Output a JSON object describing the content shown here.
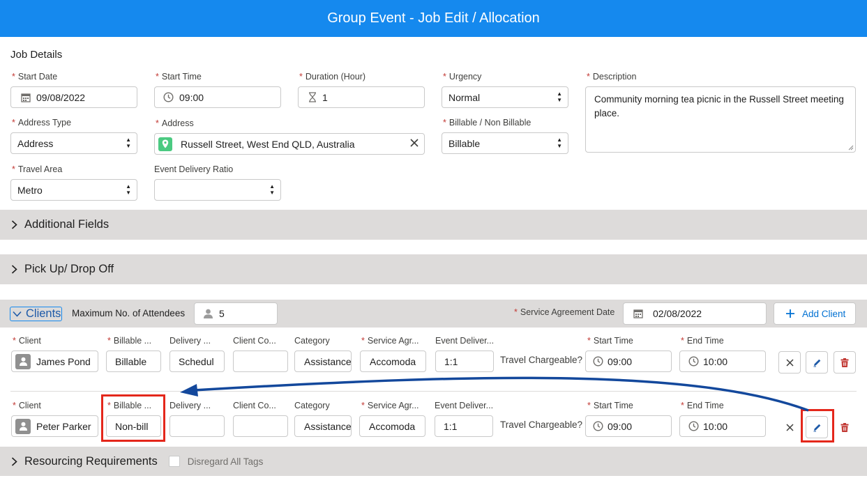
{
  "header": {
    "title": "Group Event - Job Edit / Allocation"
  },
  "job_details": {
    "title": "Job Details",
    "start_date": {
      "label": "Start Date",
      "value": "09/08/2022"
    },
    "start_time": {
      "label": "Start Time",
      "value": "09:00"
    },
    "duration": {
      "label": "Duration (Hour)",
      "value": "1"
    },
    "urgency": {
      "label": "Urgency",
      "value": "Normal"
    },
    "description": {
      "label": "Description",
      "value": "Community morning tea picnic in the Russell Street meeting place."
    },
    "address_type": {
      "label": "Address Type",
      "value": "Address"
    },
    "address": {
      "label": "Address",
      "value": "Russell Street, West End QLD, Australia"
    },
    "billable": {
      "label": "Billable / Non Billable",
      "value": "Billable"
    },
    "travel_area": {
      "label": "Travel Area",
      "value": "Metro"
    },
    "event_delivery_ratio": {
      "label": "Event Delivery Ratio",
      "value": ""
    }
  },
  "sections": {
    "additional_fields": "Additional Fields",
    "pickup": "Pick Up/ Drop Off",
    "resourcing": "Resourcing Requirements",
    "disregard_tags": "Disregard All Tags"
  },
  "clients_section": {
    "title": "Clients",
    "max_attendees_label": "Maximum No. of Attendees",
    "max_attendees_value": "5",
    "service_agreement_date_label": "Service Agreement Date",
    "service_agreement_date_value": "02/08/2022",
    "add_client_label": "Add Client",
    "columns": {
      "client": "Client",
      "billable": "Billable ...",
      "delivery": "Delivery ...",
      "client_co": "Client Co...",
      "category": "Category",
      "service_agr": "Service Agr...",
      "event_deliver_1": "Event Deliver...",
      "event_deliver_2": "Event Deliver...",
      "travel_chargeable": "Travel Chargeable?",
      "start_time": "Start Time",
      "end_time": "End Time"
    },
    "rows": [
      {
        "client": "James Pond",
        "billable": "Billable",
        "delivery": "Schedul",
        "client_co": "",
        "category": "Assistance",
        "service_agr": "Accomoda",
        "event_deliver": "1:1",
        "start_time": "09:00",
        "end_time": "10:00"
      },
      {
        "client": "Peter Parker",
        "billable": "Non-bill",
        "delivery": "",
        "client_co": "",
        "category": "Assistance",
        "service_agr": "Accomoda",
        "event_deliver": "1:1",
        "start_time": "09:00",
        "end_time": "10:00"
      }
    ]
  },
  "colors": {
    "header_bg": "#1589ee",
    "band_bg": "#dddbda",
    "required": "#c23934",
    "annotation_red": "#e4271b",
    "annotation_arrow": "#13489c",
    "delete_red": "#c23934",
    "link_blue": "#0070d2"
  }
}
